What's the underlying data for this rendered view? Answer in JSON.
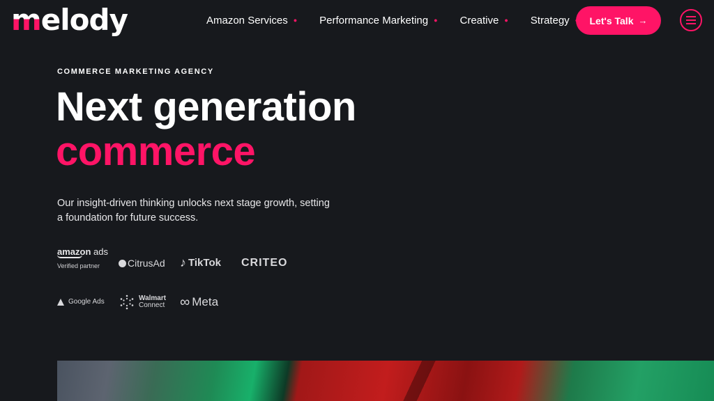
{
  "brand": {
    "name_first": "m",
    "name_rest": "elody",
    "accent_color": "#ff1466"
  },
  "nav": {
    "items": [
      {
        "label": "Amazon Services"
      },
      {
        "label": "Performance Marketing"
      },
      {
        "label": "Creative"
      },
      {
        "label": "Strategy"
      }
    ],
    "cta_label": "Let's Talk",
    "cta_icon": "arrow-right-icon",
    "menu_icon": "hamburger-menu-icon"
  },
  "hero": {
    "eyebrow": "COMMERCE MARKETING AGENCY",
    "headline_line1": "Next generation",
    "headline_line2": "commerce",
    "subtext": "Our insight-driven thinking unlocks next stage growth, setting a foundation for future success."
  },
  "partners": {
    "amazon": {
      "name": "amazon",
      "suffix": "ads",
      "badge": "Verified partner"
    },
    "citrus": "CitrusAd",
    "tiktok": "TikTok",
    "criteo": "CRITEO",
    "google": "Google Ads",
    "walmart_line1": "Walmart",
    "walmart_line2": "Connect",
    "meta": "Meta"
  },
  "colors": {
    "background": "#17191d",
    "accent": "#ff1466",
    "text": "#ffffff"
  }
}
